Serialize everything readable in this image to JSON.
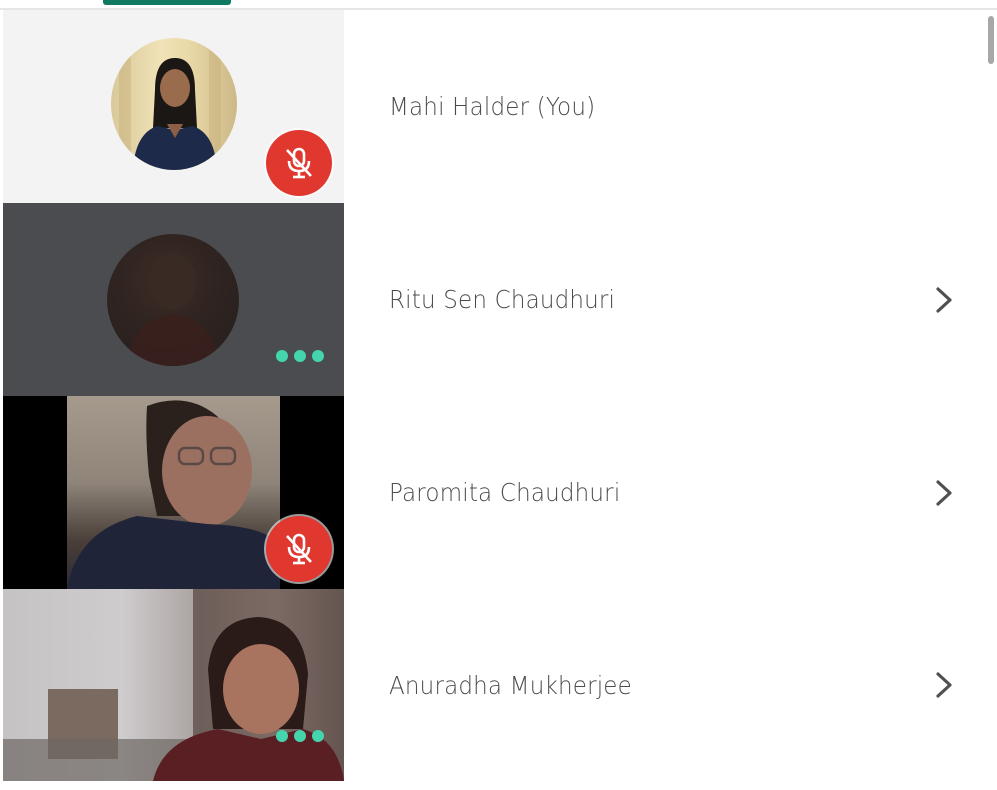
{
  "participants": [
    {
      "name": "Mahi Halder (You)",
      "muted": true,
      "has_chevron": false,
      "status": "mic-off"
    },
    {
      "name": "Ritu Sen Chaudhuri",
      "muted": false,
      "has_chevron": true,
      "status": "more-options"
    },
    {
      "name": "Paromita Chaudhuri",
      "muted": true,
      "has_chevron": true,
      "status": "mic-off"
    },
    {
      "name": "Anuradha Mukherjee",
      "muted": false,
      "has_chevron": true,
      "status": "more-options"
    }
  ],
  "icons": {
    "mute": "mic-off-icon",
    "more": "more-dots-icon",
    "chevron": "chevron-right-icon"
  },
  "colors": {
    "accent": "#0f7a60",
    "mute_badge": "#e0372f",
    "dots": "#45d5ad",
    "name_text": "#4b4b4b"
  }
}
